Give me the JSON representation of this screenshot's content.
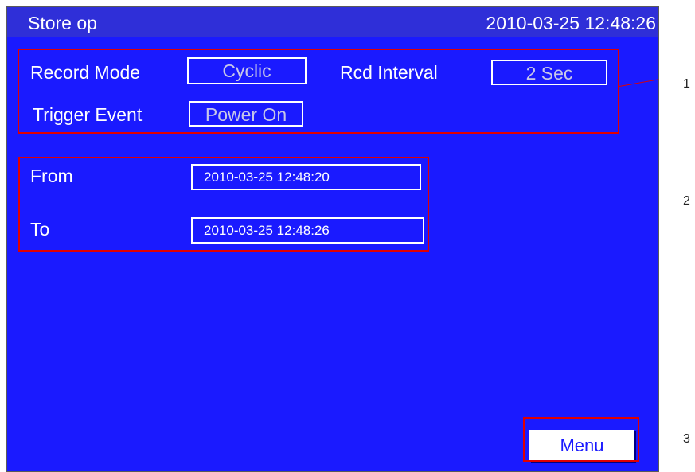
{
  "header": {
    "title": "Store op",
    "datetime": "2010-03-25 12:48:26"
  },
  "settings": {
    "record_mode_label": "Record Mode",
    "record_mode_value": "Cyclic",
    "rcd_interval_label": "Rcd Interval",
    "rcd_interval_value": "2 Sec",
    "trigger_event_label": "Trigger Event",
    "trigger_event_value": "Power On"
  },
  "range": {
    "from_label": "From",
    "from_value": "2010-03-25 12:48:20",
    "to_label": "To",
    "to_value": "2010-03-25 12:48:26"
  },
  "footer": {
    "menu_label": "Menu"
  },
  "callouts": [
    "1",
    "2",
    "3"
  ],
  "colors": {
    "screen_bg": "#1a1aff",
    "highlight": "#e00000"
  }
}
